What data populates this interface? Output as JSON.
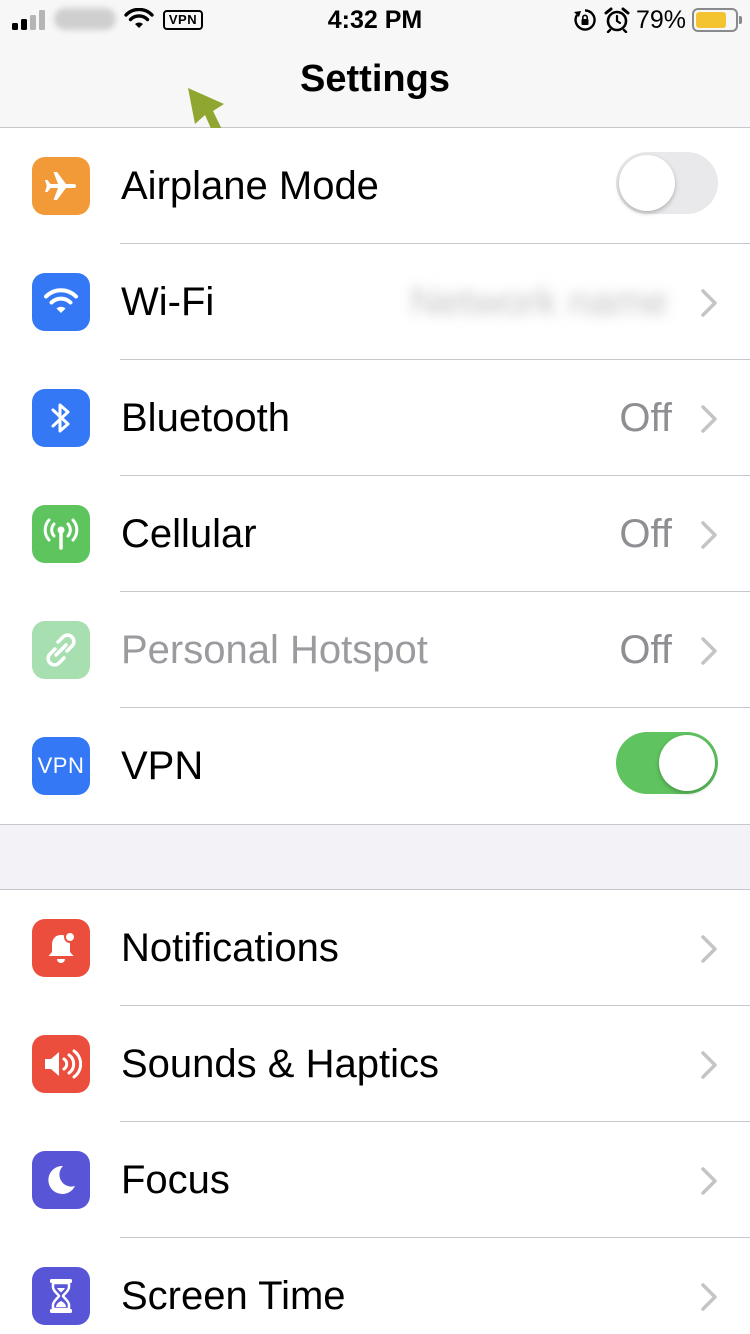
{
  "status_bar": {
    "time": "4:32 PM",
    "vpn_badge": "VPN",
    "battery_percent": "79%",
    "battery_level": 0.79,
    "icons": [
      "signal-icon",
      "wifi-icon",
      "vpn-badge",
      "rotation-lock-icon",
      "alarm-icon",
      "battery-icon"
    ]
  },
  "nav": {
    "title": "Settings"
  },
  "colors": {
    "airplane": "#f19a37",
    "wifi": "#3478f6",
    "bluetooth": "#3478f6",
    "cellular": "#5ec55e",
    "hotspot": "#a8dfb0",
    "vpn": "#3478f6",
    "notifications": "#eb4e3d",
    "sounds": "#eb4e3d",
    "focus": "#5856d6",
    "screen_time": "#5856d6",
    "toggle_on": "#5fc35f",
    "annotation_arrow": "#8fa631"
  },
  "groups": {
    "connectivity": [
      {
        "label": "Airplane Mode",
        "icon": "airplane-icon",
        "control": "toggle",
        "on": false
      },
      {
        "label": "Wi-Fi",
        "icon": "wifi-icon",
        "value": "Network name",
        "value_blurred": true
      },
      {
        "label": "Bluetooth",
        "icon": "bluetooth-icon",
        "value": "Off"
      },
      {
        "label": "Cellular",
        "icon": "antenna-icon",
        "value": "Off"
      },
      {
        "label": "Personal Hotspot",
        "icon": "hotspot-icon",
        "value": "Off",
        "disabled": true
      },
      {
        "label": "VPN",
        "icon": "vpn-icon",
        "icon_text": "VPN",
        "control": "toggle",
        "on": true
      }
    ],
    "system": [
      {
        "label": "Notifications",
        "icon": "bell-icon"
      },
      {
        "label": "Sounds & Haptics",
        "icon": "speaker-icon"
      },
      {
        "label": "Focus",
        "icon": "moon-icon"
      },
      {
        "label": "Screen Time",
        "icon": "hourglass-icon"
      }
    ]
  }
}
